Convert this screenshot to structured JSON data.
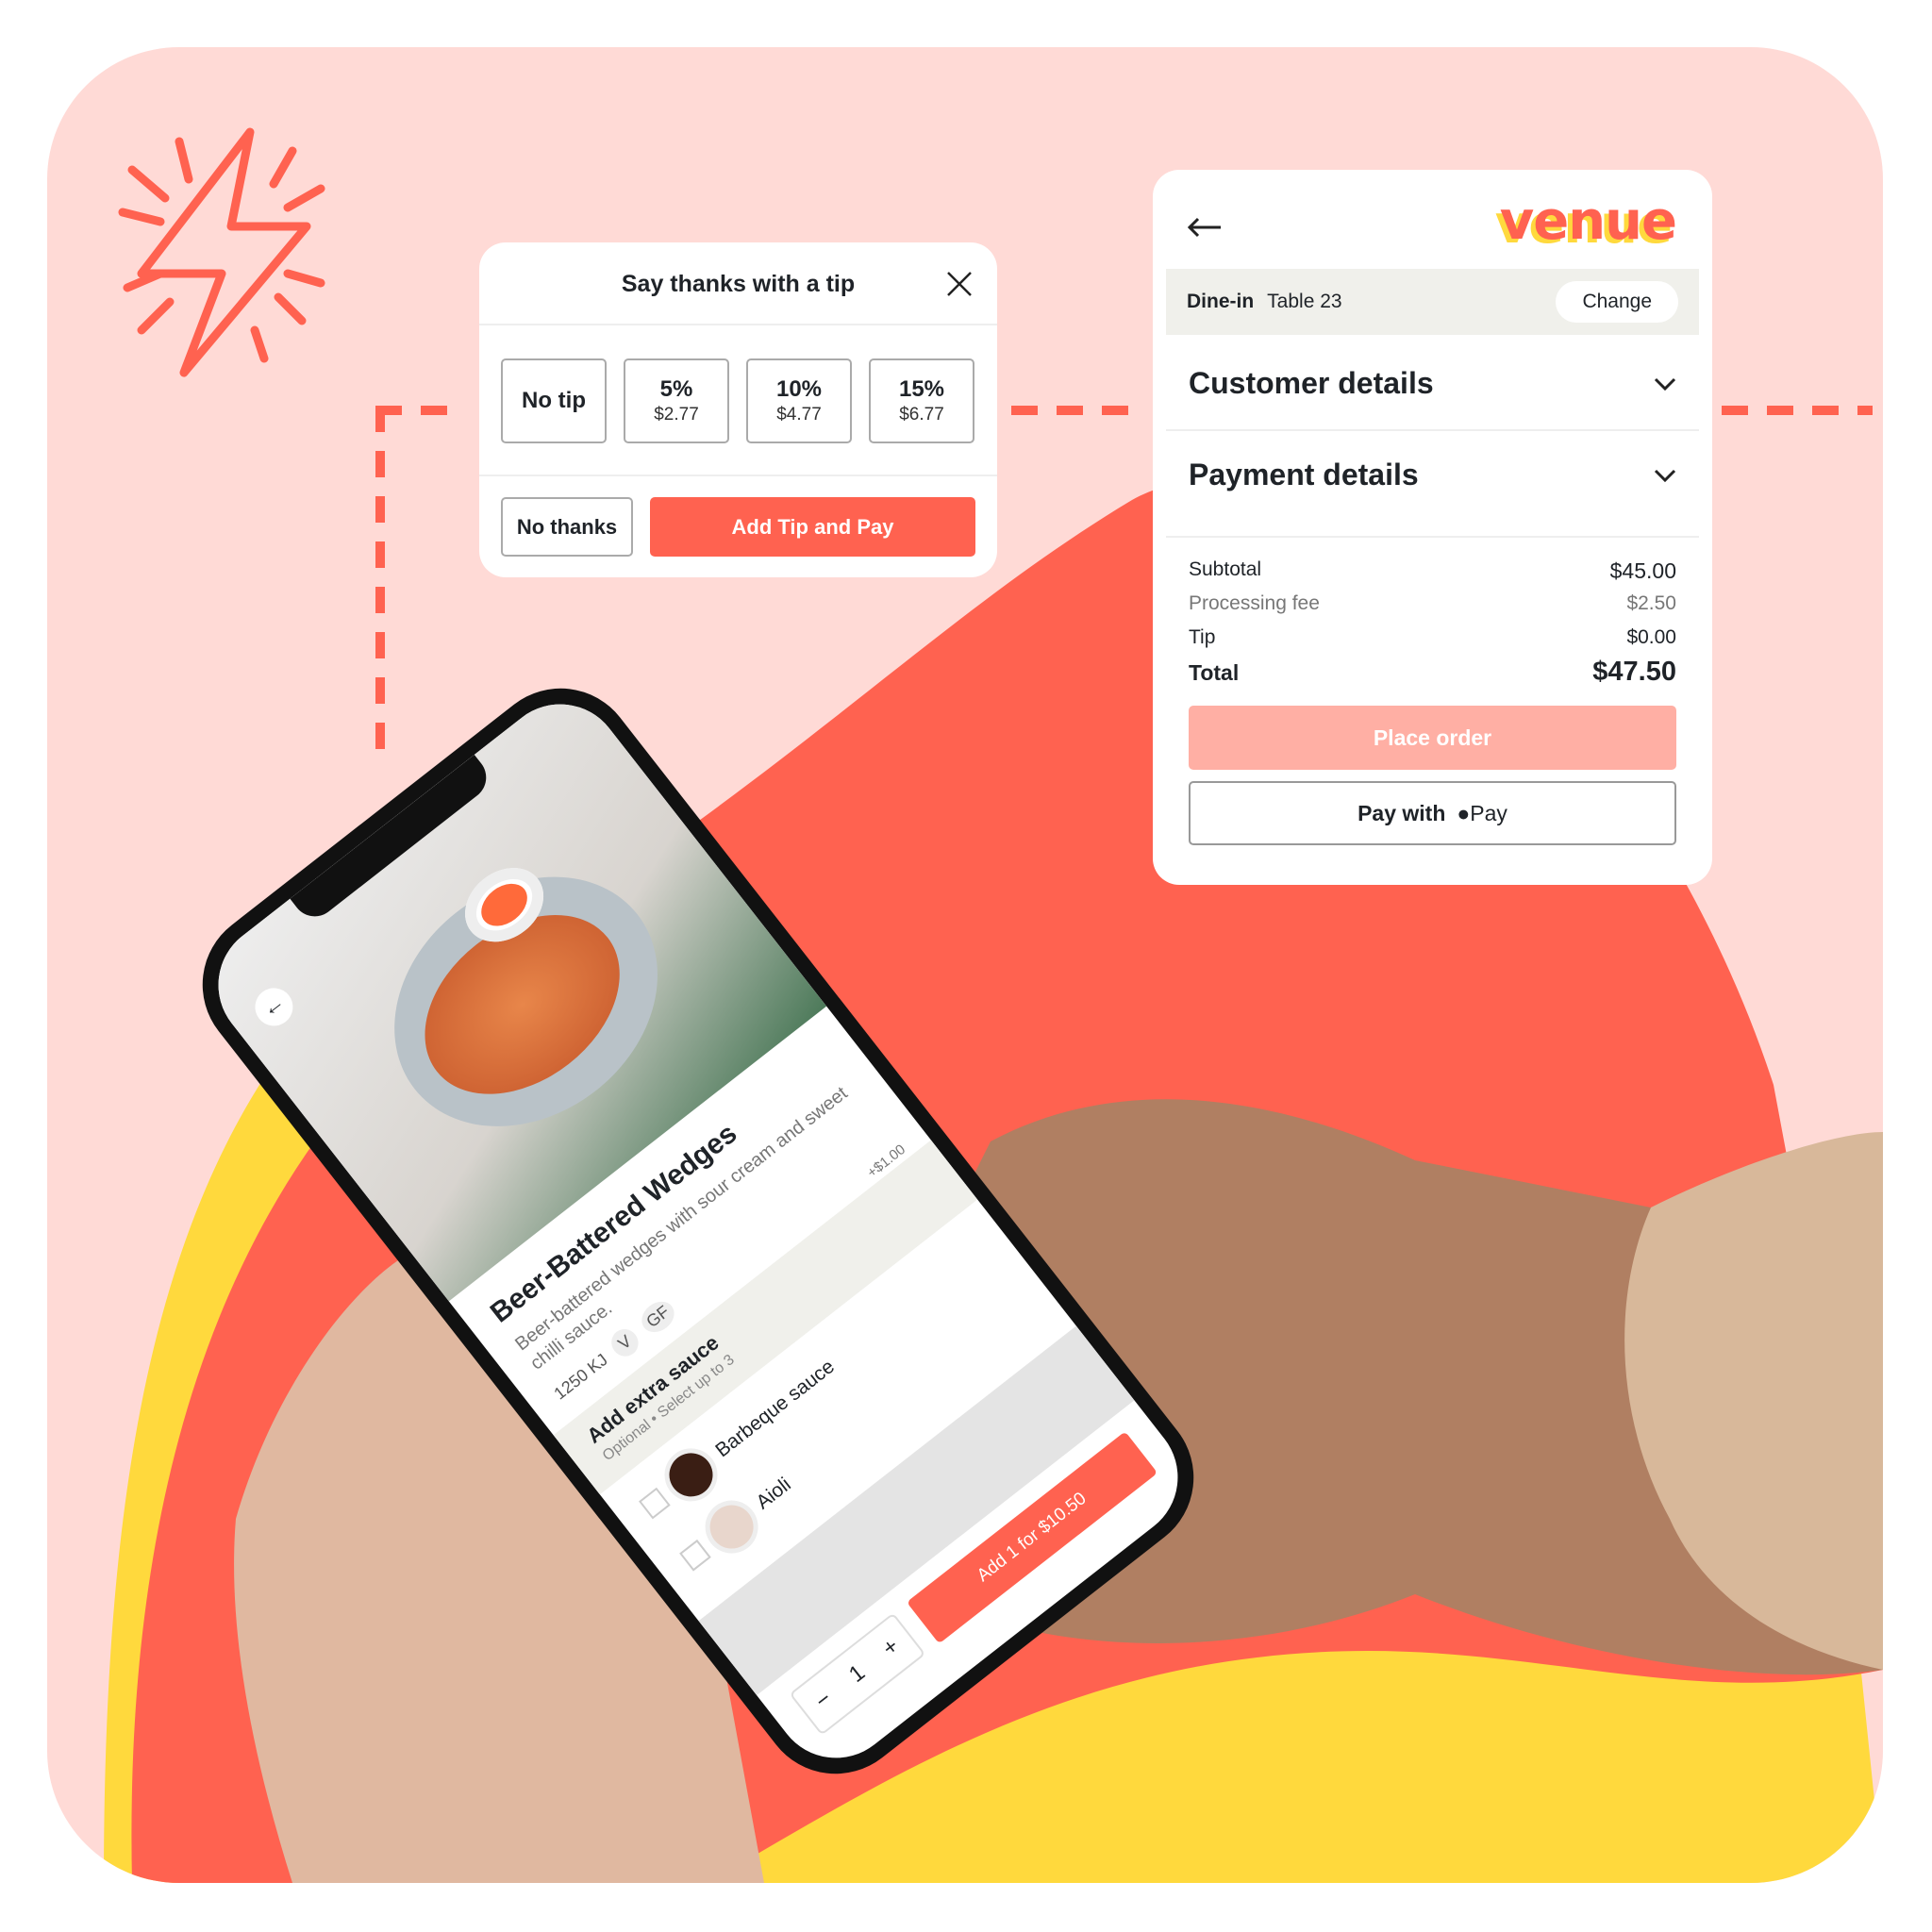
{
  "colors": {
    "background": "#FFDAD6",
    "accent": "#FF6250",
    "accent_light": "#FFAFA4",
    "yellow": "#FFD93D"
  },
  "tip_dialog": {
    "title": "Say thanks with a tip",
    "close_icon": "close-icon",
    "options": [
      {
        "label": "No tip"
      },
      {
        "label": "5%",
        "amount": "$2.77"
      },
      {
        "label": "10%",
        "amount": "$4.77"
      },
      {
        "label": "15%",
        "amount": "$6.77"
      }
    ],
    "no_thanks": "No thanks",
    "add_tip_pay": "Add Tip and Pay"
  },
  "checkout": {
    "logo": "venue",
    "back_icon": "arrow-left-icon",
    "dine_in": "Dine-in",
    "table": "Table 23",
    "change": "Change",
    "customer_details": "Customer details",
    "payment_details": "Payment details",
    "summary": [
      {
        "label": "Subtotal",
        "value": "$45.00"
      },
      {
        "label": "Processing fee",
        "value": "$2.50"
      },
      {
        "label": "Tip",
        "value": "$0.00"
      },
      {
        "label": "Total",
        "value": "$47.50"
      }
    ],
    "place_order": "Place order",
    "pay_with": "Pay with",
    "apple_pay": "Pay"
  },
  "phone": {
    "item_title": "Beer-Battered Wedges",
    "description": "Beer-battered wedges with sour cream and sweet chilli sauce.",
    "energy": "1250 KJ",
    "badges": [
      "V",
      "GF"
    ],
    "section_title": "Add extra sauce",
    "section_sub": "Optional • Select up to 3",
    "section_price": "+$1.00",
    "options": [
      "Barbeque sauce",
      "Aioli"
    ],
    "quantity": "1",
    "add_button": "Add 1 for $10.50"
  }
}
